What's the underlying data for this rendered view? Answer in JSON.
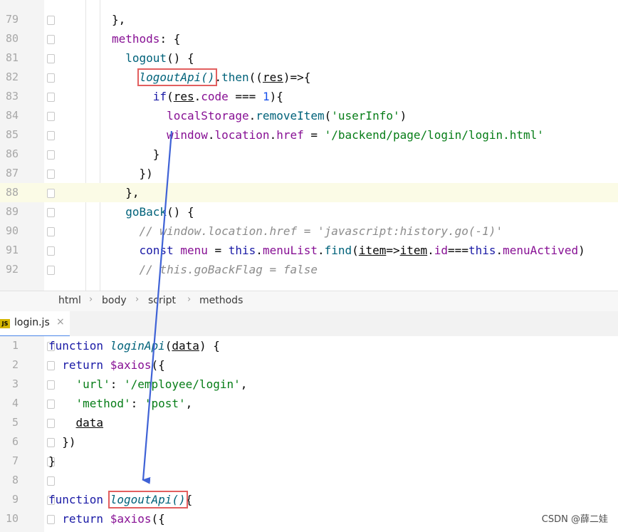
{
  "top_editor": {
    "lines": [
      {
        "num": "79",
        "parts": [
          {
            "t": "},",
            "c": "dark"
          }
        ]
      },
      {
        "num": "80",
        "parts": [
          {
            "t": "methods",
            "c": "prop"
          },
          {
            "t": ": {",
            "c": "dark"
          }
        ]
      },
      {
        "num": "81",
        "parts": [
          {
            "t": "  logout",
            "c": "fn"
          },
          {
            "t": "() {",
            "c": "dark"
          }
        ]
      },
      {
        "num": "82",
        "parts": [
          {
            "t": "    ",
            "c": "dark"
          },
          {
            "t": "logoutApi()",
            "c": "fn it",
            "box": true
          },
          {
            "t": ".",
            "c": "dark"
          },
          {
            "t": "then",
            "c": "fn"
          },
          {
            "t": "((",
            "c": "dark"
          },
          {
            "t": "res",
            "c": "dark ul"
          },
          {
            "t": ")=>{",
            "c": "dark"
          }
        ]
      },
      {
        "num": "83",
        "parts": [
          {
            "t": "      ",
            "c": "dark"
          },
          {
            "t": "if",
            "c": "kw"
          },
          {
            "t": "(",
            "c": "dark"
          },
          {
            "t": "res",
            "c": "dark ul"
          },
          {
            "t": ".",
            "c": "dark"
          },
          {
            "t": "code",
            "c": "prop"
          },
          {
            "t": " === ",
            "c": "dark"
          },
          {
            "t": "1",
            "c": "num"
          },
          {
            "t": "){",
            "c": "dark"
          }
        ]
      },
      {
        "num": "84",
        "parts": [
          {
            "t": "        ",
            "c": "dark"
          },
          {
            "t": "localStorage",
            "c": "prop"
          },
          {
            "t": ".",
            "c": "dark"
          },
          {
            "t": "removeItem",
            "c": "fn"
          },
          {
            "t": "(",
            "c": "dark"
          },
          {
            "t": "'userInfo'",
            "c": "str"
          },
          {
            "t": ")",
            "c": "dark"
          }
        ]
      },
      {
        "num": "85",
        "parts": [
          {
            "t": "        ",
            "c": "dark"
          },
          {
            "t": "window",
            "c": "prop"
          },
          {
            "t": ".",
            "c": "dark"
          },
          {
            "t": "location",
            "c": "prop"
          },
          {
            "t": ".",
            "c": "dark"
          },
          {
            "t": "href",
            "c": "prop"
          },
          {
            "t": " = ",
            "c": "dark"
          },
          {
            "t": "'/backend/page/login/login.html'",
            "c": "str"
          }
        ]
      },
      {
        "num": "86",
        "parts": [
          {
            "t": "      }",
            "c": "dark"
          }
        ]
      },
      {
        "num": "87",
        "parts": [
          {
            "t": "    })",
            "c": "dark"
          }
        ]
      },
      {
        "num": "88",
        "parts": [
          {
            "t": "  },",
            "c": "dark"
          }
        ],
        "hl": true
      },
      {
        "num": "89",
        "parts": [
          {
            "t": "  goBack",
            "c": "fn"
          },
          {
            "t": "() {",
            "c": "dark"
          }
        ]
      },
      {
        "num": "90",
        "parts": [
          {
            "t": "    // window.location.href = 'javascript:history.go(-1)'",
            "c": "cm"
          }
        ]
      },
      {
        "num": "91",
        "parts": [
          {
            "t": "    ",
            "c": "dark"
          },
          {
            "t": "const",
            "c": "kw"
          },
          {
            "t": " menu ",
            "c": "prop"
          },
          {
            "t": "= ",
            "c": "dark"
          },
          {
            "t": "this",
            "c": "kw"
          },
          {
            "t": ".",
            "c": "dark"
          },
          {
            "t": "menuList",
            "c": "prop"
          },
          {
            "t": ".",
            "c": "dark"
          },
          {
            "t": "find",
            "c": "fn"
          },
          {
            "t": "(",
            "c": "dark"
          },
          {
            "t": "item",
            "c": "dark ul"
          },
          {
            "t": "=>",
            "c": "dark"
          },
          {
            "t": "item",
            "c": "dark ul"
          },
          {
            "t": ".",
            "c": "dark"
          },
          {
            "t": "id",
            "c": "prop"
          },
          {
            "t": "===",
            "c": "dark"
          },
          {
            "t": "this",
            "c": "kw"
          },
          {
            "t": ".",
            "c": "dark"
          },
          {
            "t": "menuActived",
            "c": "prop"
          },
          {
            "t": ")",
            "c": "dark"
          }
        ]
      },
      {
        "num": "92",
        "parts": [
          {
            "t": "    // this.goBackFlag = false",
            "c": "cm"
          }
        ]
      }
    ]
  },
  "breadcrumb": [
    "html",
    "body",
    "script",
    "methods"
  ],
  "tab": {
    "label": "login.js",
    "icon": "js-file-icon",
    "close": "×",
    "icon_text": "JS"
  },
  "bottom_editor": {
    "lines": [
      {
        "num": "1",
        "parts": [
          {
            "t": "function ",
            "c": "kw"
          },
          {
            "t": "loginApi",
            "c": "fn it"
          },
          {
            "t": "(",
            "c": "dark"
          },
          {
            "t": "data",
            "c": "dark ul"
          },
          {
            "t": ") {",
            "c": "dark"
          }
        ]
      },
      {
        "num": "2",
        "parts": [
          {
            "t": "  ",
            "c": "dark"
          },
          {
            "t": "return ",
            "c": "kw"
          },
          {
            "t": "$axios",
            "c": "prop"
          },
          {
            "t": "({",
            "c": "dark"
          }
        ]
      },
      {
        "num": "3",
        "parts": [
          {
            "t": "    ",
            "c": "dark"
          },
          {
            "t": "'url'",
            "c": "str"
          },
          {
            "t": ": ",
            "c": "dark"
          },
          {
            "t": "'/employee/login'",
            "c": "str"
          },
          {
            "t": ",",
            "c": "dark"
          }
        ]
      },
      {
        "num": "4",
        "parts": [
          {
            "t": "    ",
            "c": "dark"
          },
          {
            "t": "'method'",
            "c": "str"
          },
          {
            "t": ": ",
            "c": "dark"
          },
          {
            "t": "'post'",
            "c": "str"
          },
          {
            "t": ",",
            "c": "dark"
          }
        ]
      },
      {
        "num": "5",
        "parts": [
          {
            "t": "    ",
            "c": "dark"
          },
          {
            "t": "data",
            "c": "dark ul"
          }
        ]
      },
      {
        "num": "6",
        "parts": [
          {
            "t": "  })",
            "c": "dark"
          }
        ]
      },
      {
        "num": "7",
        "parts": [
          {
            "t": "}",
            "c": "dark"
          }
        ]
      },
      {
        "num": "8",
        "parts": [
          {
            "t": "",
            "c": "dark"
          }
        ]
      },
      {
        "num": "9",
        "parts": [
          {
            "t": "function ",
            "c": "kw"
          },
          {
            "t": "logoutApi()",
            "c": "fn it",
            "box": true
          },
          {
            "t": "{",
            "c": "dark"
          }
        ]
      },
      {
        "num": "10",
        "parts": [
          {
            "t": "  ",
            "c": "dark"
          },
          {
            "t": "return ",
            "c": "kw"
          },
          {
            "t": "$axios",
            "c": "prop"
          },
          {
            "t": "({",
            "c": "dark"
          }
        ]
      }
    ]
  },
  "watermark": "CSDN @薛二娃",
  "colors": {
    "annotation_box": "#e25f5f",
    "arrow": "#3f62d6"
  }
}
